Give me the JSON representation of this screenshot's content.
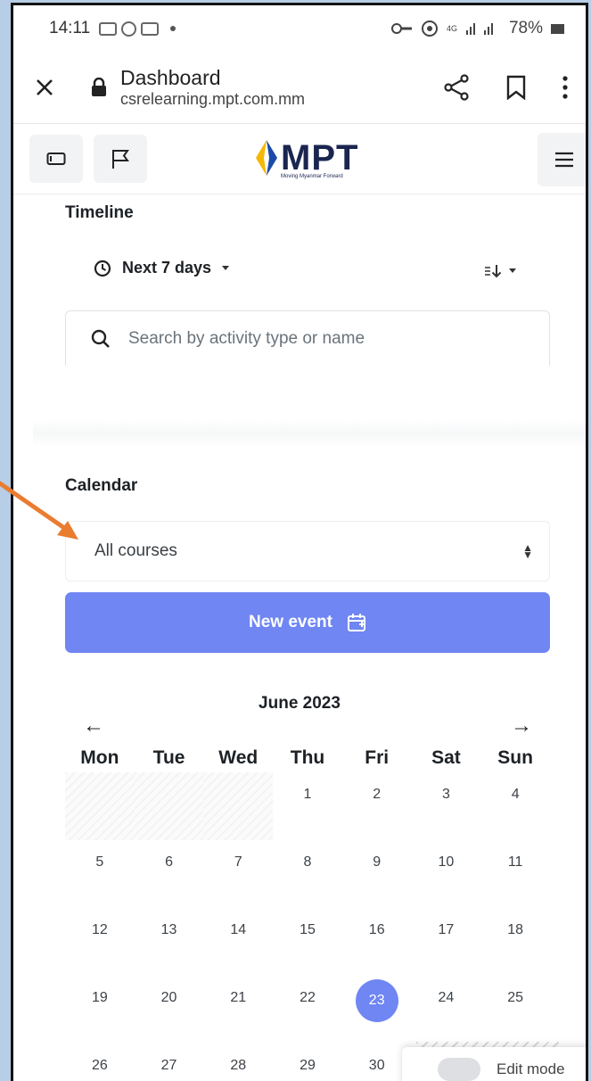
{
  "status_bar": {
    "time": "14:11",
    "battery": "78%",
    "network": "4G"
  },
  "url_bar": {
    "title": "Dashboard",
    "host": "csrelearning.mpt.com.mm"
  },
  "header": {
    "logo_text": "MPT",
    "logo_tagline": "Moving Myanmar Forward"
  },
  "timeline": {
    "title": "Timeline",
    "filter_label": "Next 7 days",
    "search_placeholder": "Search by activity type or name"
  },
  "calendar": {
    "title": "Calendar",
    "course_filter": "All courses",
    "new_event_label": "New event",
    "month_label": "June 2023",
    "prev_arrow": "←",
    "next_arrow": "→",
    "weekdays": [
      "Mon",
      "Tue",
      "Wed",
      "Thu",
      "Fri",
      "Sat",
      "Sun"
    ],
    "leading_blank_days": 3,
    "days": [
      1,
      2,
      3,
      4,
      5,
      6,
      7,
      8,
      9,
      10,
      11,
      12,
      13,
      14,
      15,
      16,
      17,
      18,
      19,
      20,
      21,
      22,
      23,
      24,
      25,
      26,
      27,
      28,
      29,
      30
    ],
    "today": 23
  },
  "footer": {
    "edit_mode_label": "Edit mode"
  },
  "colors": {
    "accent": "#6f86f3",
    "annotation_arrow": "#ea7c30",
    "logo_yellow": "#f5b800",
    "logo_blue": "#1b4aa8"
  }
}
